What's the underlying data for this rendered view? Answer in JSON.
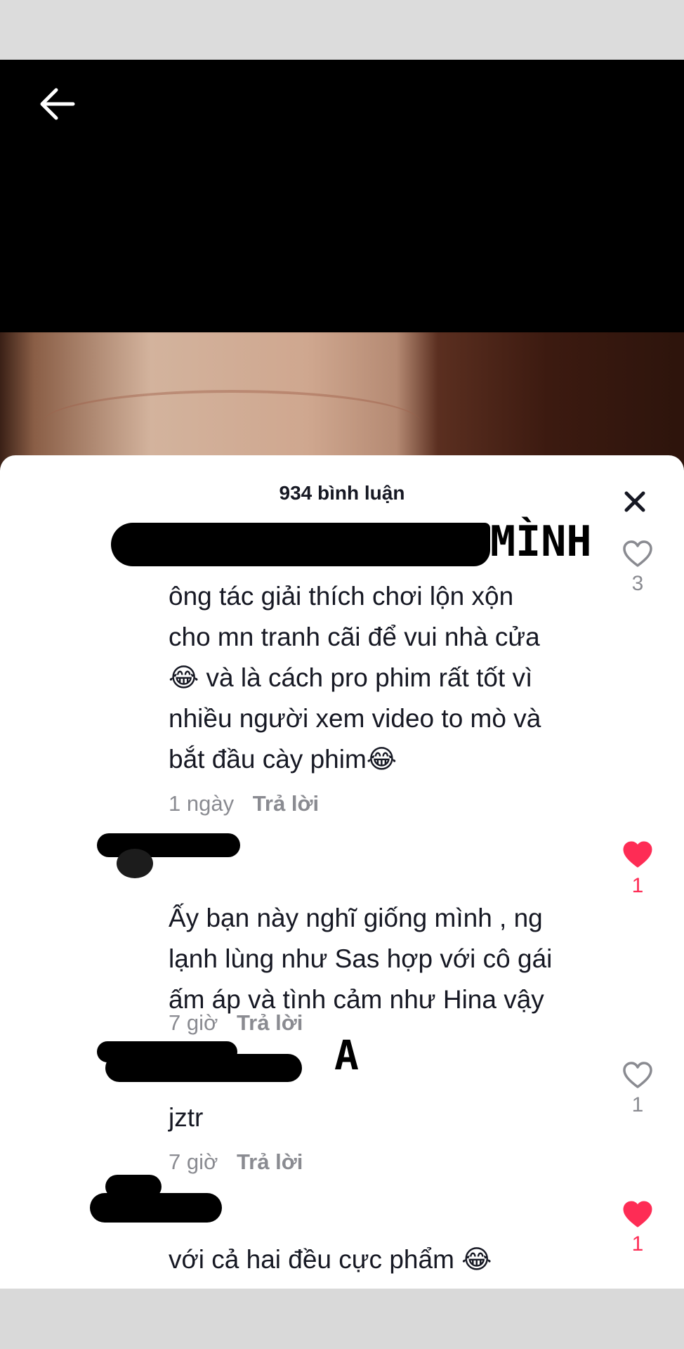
{
  "video": {
    "back_label": "back"
  },
  "comments_panel": {
    "title": "934 bình luận",
    "close_label": "close"
  },
  "annotations": {
    "minh": "MÌNH",
    "a": "A"
  },
  "comments": [
    {
      "text_lines": [
        "ông tác giải thích chơi lộn xộn",
        "cho mn tranh cãi để vui nhà cửa",
        "😂 và là cách pro phim rất tốt vì",
        "nhiều người xem video to mò và",
        "bắt đầu cày phim😂"
      ],
      "time": "1 ngày",
      "reply": "Trả lời",
      "likes": "3",
      "liked": false
    },
    {
      "text_lines": [
        "Ấy bạn này nghĩ giống mình , ng",
        "lạnh lùng như Sas hợp với cô gái",
        "ấm áp và tình cảm như Hina vậy"
      ],
      "time": "7 giờ",
      "reply": "Trả lời",
      "likes": "1",
      "liked": true
    },
    {
      "text_lines": [
        "jztr"
      ],
      "time": "7 giờ",
      "reply": "Trả lời",
      "likes": "1",
      "liked": false
    },
    {
      "text_lines": [
        "với cả hai đều cực phẩm 😂"
      ],
      "likes": "1",
      "liked": true
    }
  ],
  "colors": {
    "liked": "#fe2c55",
    "muted": "#8a8b91",
    "text": "#161823"
  },
  "icons": {
    "back": "arrow-left-icon",
    "close": "close-icon",
    "like": "heart-icon"
  }
}
